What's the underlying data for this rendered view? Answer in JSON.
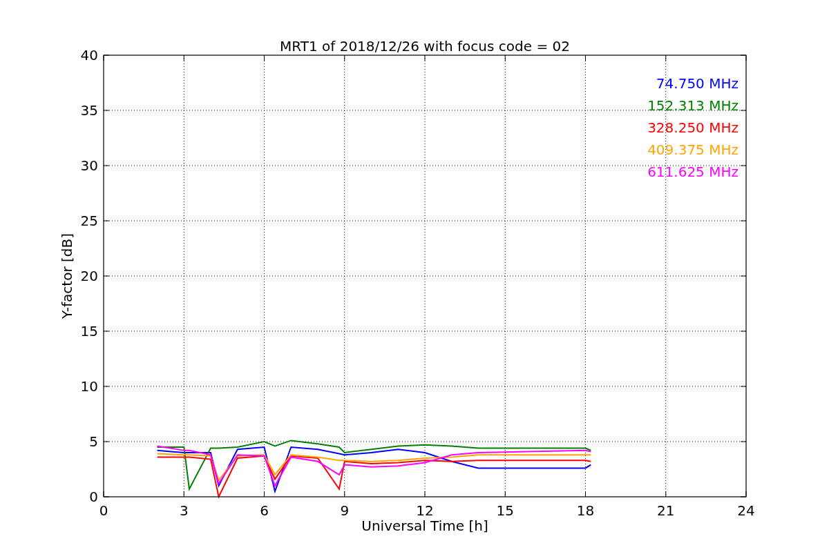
{
  "chart_data": {
    "type": "line",
    "title": "MRT1 of 2018/12/26 with focus code = 02",
    "xlabel": "Universal Time [h]",
    "ylabel": "Y-factor [dB]",
    "x": [
      2,
      3,
      3.2,
      4,
      4.3,
      5,
      6,
      6.4,
      7,
      8,
      8.8,
      9,
      10,
      11,
      12,
      13,
      14,
      18,
      18.2
    ],
    "series": [
      {
        "name": "74.750 MHz",
        "color": "#0000ff",
        "values": [
          4.2,
          4.0,
          4.0,
          4.0,
          1.0,
          4.3,
          4.5,
          0.5,
          4.5,
          4.3,
          3.9,
          3.8,
          4.0,
          4.3,
          4.0,
          3.2,
          2.6,
          2.6,
          2.9
        ]
      },
      {
        "name": "152.313 MHz",
        "color": "#008000",
        "values": [
          4.5,
          4.5,
          0.7,
          4.4,
          4.4,
          4.5,
          5.0,
          4.6,
          5.1,
          4.8,
          4.5,
          4.0,
          4.3,
          4.6,
          4.7,
          4.6,
          4.4,
          4.4,
          4.2
        ]
      },
      {
        "name": "328.250 MHz",
        "color": "#ff0000",
        "values": [
          3.6,
          3.6,
          3.6,
          3.4,
          0.0,
          3.5,
          3.7,
          1.6,
          3.7,
          3.5,
          0.7,
          3.2,
          3.0,
          3.1,
          3.3,
          3.2,
          3.3,
          3.3,
          3.2
        ]
      },
      {
        "name": "409.375 MHz",
        "color": "#ffa500",
        "values": [
          3.9,
          3.8,
          3.8,
          3.7,
          1.5,
          3.7,
          3.8,
          2.0,
          3.8,
          3.6,
          3.3,
          3.3,
          3.2,
          3.3,
          3.5,
          3.6,
          3.8,
          3.8,
          3.8
        ]
      },
      {
        "name": "611.625 MHz",
        "color": "#ff00ff",
        "values": [
          4.6,
          4.2,
          4.2,
          3.8,
          1.2,
          3.8,
          3.7,
          1.0,
          3.6,
          3.2,
          2.0,
          2.9,
          2.7,
          2.8,
          3.1,
          3.8,
          4.0,
          4.2,
          4.1
        ]
      }
    ],
    "xlim": [
      0,
      24
    ],
    "ylim": [
      0,
      40
    ],
    "xticks": [
      0,
      3,
      6,
      9,
      12,
      15,
      18,
      21,
      24
    ],
    "yticks": [
      0,
      5,
      10,
      15,
      20,
      25,
      30,
      35,
      40
    ],
    "grid": true
  }
}
